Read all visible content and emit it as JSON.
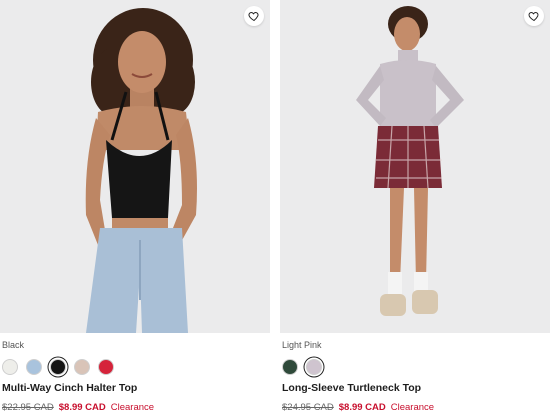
{
  "colors": {
    "sale_red": "#c8102e",
    "photo_bg": "#ececed"
  },
  "products": [
    {
      "color_label": "Black",
      "name": "Multi-Way Cinch Halter Top",
      "original_price": "$22.95 CAD",
      "sale_price": "$8.99 CAD",
      "badge": "Clearance",
      "wishlist_icon": "heart-icon",
      "swatches": [
        {
          "name": "white",
          "color": "#eeeeea",
          "selected": false
        },
        {
          "name": "light-blue",
          "color": "#a9c3dd",
          "selected": false
        },
        {
          "name": "black",
          "color": "#151515",
          "selected": true
        },
        {
          "name": "floral",
          "color": "#d9c4b8",
          "selected": false
        },
        {
          "name": "red",
          "color": "#d5233a",
          "selected": false
        }
      ]
    },
    {
      "color_label": "Light Pink",
      "name": "Long-Sleeve Turtleneck Top",
      "original_price": "$24.95 CAD",
      "sale_price": "$8.99 CAD",
      "badge": "Clearance",
      "wishlist_icon": "heart-icon",
      "swatches": [
        {
          "name": "dark-green",
          "color": "#2f4a3a",
          "selected": false
        },
        {
          "name": "light-pink",
          "color": "#cfc4cf",
          "selected": true
        }
      ]
    }
  ]
}
